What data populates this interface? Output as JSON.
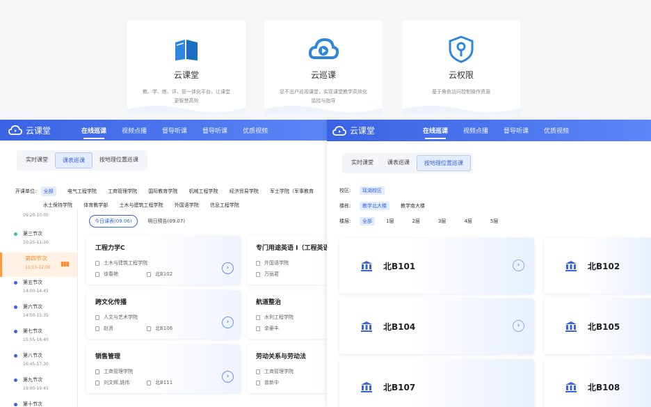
{
  "features": [
    {
      "icon": "book-icon",
      "title": "云课堂",
      "desc": "教、学、练、评、管一体化平台，让课堂更智慧高效"
    },
    {
      "icon": "cloud-play-icon",
      "title": "云巡课",
      "desc": "足不出户巡视课堂，实现课堂教学高效化监控与指导"
    },
    {
      "icon": "shield-key-icon",
      "title": "云权限",
      "desc": "基于角色访问控制操作资源"
    }
  ],
  "left": {
    "brand": "云课堂",
    "nav": [
      "在线巡课",
      "视频点播",
      "督导听课",
      "督导听课",
      "优质视频"
    ],
    "tabs": [
      "实时课堂",
      "课表巡课",
      "按地理位置巡课"
    ],
    "units_label": "开课单位:",
    "units": [
      "全部",
      "电气工程学院",
      "工商管理学院",
      "国际教育学院",
      "机械工程学院",
      "经济贸易学院",
      "军士学院（军事教育"
    ],
    "units2": [
      "水土保持学院",
      "体育教学部",
      "土木与建筑工程学院",
      "外国语学院",
      "信息工程学院"
    ],
    "first_time": "09:20-10:05",
    "sessions": [
      {
        "name": "第三节次",
        "time": "10:25-11:10"
      },
      {
        "name": "第四节次",
        "time": "11:15-12:00"
      },
      {
        "name": "第五节次",
        "time": "14:00-14:45"
      },
      {
        "name": "第六节次",
        "time": "14:50-15:35"
      },
      {
        "name": "第七节次",
        "time": "15:55-16:40"
      },
      {
        "name": "第八节次",
        "time": "16:45-17:30"
      },
      {
        "name": "第九节次",
        "time": "19:00-19:45"
      },
      {
        "name": "第十节次",
        "time": ""
      }
    ],
    "day_tabs": [
      "今日课表(09.06)",
      "明日预告(09.07)"
    ],
    "courses": [
      {
        "title": "工程力学C",
        "college": "土木与建筑工程学院",
        "teacher": "徐春艳",
        "room": "北B102"
      },
      {
        "title": "专门用途英语 I（工程英语I",
        "college": "外国语学院",
        "teacher": "万丽君",
        "room": ""
      },
      {
        "title": "跨文化传播",
        "college": "人文与艺术学院",
        "teacher": "赵贤",
        "room": "北B106"
      },
      {
        "title": "航道整治",
        "college": "水利工程学院",
        "teacher": "余豪丰",
        "room": ""
      },
      {
        "title": "销售管理",
        "college": "工商管理学院",
        "teacher": "刘文辉,姚伟",
        "room": "北B111"
      },
      {
        "title": "劳动关系与劳动法",
        "college": "工商管理学院",
        "teacher": "曾新中",
        "room": ""
      }
    ]
  },
  "right": {
    "brand": "云课堂",
    "nav": [
      "在线巡课",
      "视频点播",
      "督导听课",
      "优质视频"
    ],
    "tabs": [
      "实时课堂",
      "课表巡课",
      "按地理位置巡课"
    ],
    "campus_label": "校区:",
    "campus": [
      "瑶湖校区"
    ],
    "building_label": "楼栋:",
    "buildings": [
      "教学北大楼",
      "教学南大楼"
    ],
    "floor_label": "楼层:",
    "floors": [
      "全部",
      "1层",
      "2层",
      "3层",
      "4层",
      "5层"
    ],
    "rooms": [
      "北B101",
      "北B102",
      "北B104",
      "北B105",
      "北B107",
      "北B108"
    ]
  },
  "colors": {
    "primary": "#3a63e4",
    "active_session": "#ff8a2a",
    "selected_bg": "#e3ecff"
  }
}
